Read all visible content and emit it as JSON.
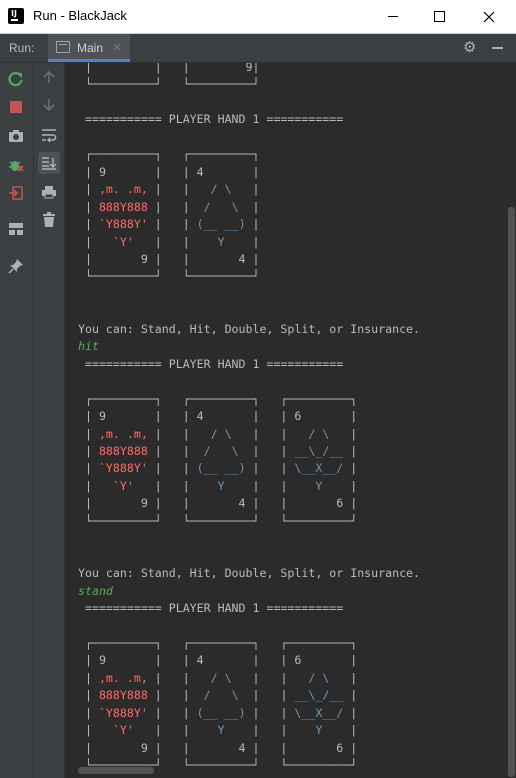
{
  "window": {
    "title": "Run - BlackJack",
    "app_icon_text": "IJ",
    "minimize_icon": "minimize-icon",
    "maximize_icon": "maximize-icon",
    "close_icon": "close-icon"
  },
  "run_header": {
    "label": "Run:",
    "tab_label": "Main",
    "tab_close": "×"
  },
  "toolbar_left": [
    "rerun-icon",
    "stop-icon",
    "screenshot-icon",
    "debug-icon",
    "exit-icon",
    "layout-icon",
    "pin-icon"
  ],
  "toolbar_right": [
    "up-arrow-icon",
    "down-arrow-icon",
    "soft-wrap-icon",
    "scroll-to-end-icon",
    "print-icon",
    "trash-icon"
  ],
  "colors": {
    "background": "#2b2b2b",
    "hearts": "#ff6b68",
    "spades": "#6897bb",
    "user_input": "#5fa85a",
    "text": "#bbbbbb",
    "accent": "#4a88c7"
  },
  "console": {
    "lines": [
      {
        "text": " |         |   |        9|",
        "color": ""
      },
      {
        "text": " └─────────┘   └─────────┘",
        "color": ""
      },
      {
        "text": "",
        "color": ""
      },
      {
        "text": " =========== PLAYER HAND 1 ===========",
        "color": ""
      },
      {
        "text": "",
        "color": ""
      },
      {
        "text": " ┌─────────┐   ┌─────────┐",
        "color": ""
      },
      {
        "text": " | 9       |   | 4       |",
        "color": ""
      },
      {
        "text": " | ,m. .m, |   |   / \\   |",
        "color": "mix1"
      },
      {
        "text": " | 888Y888 |   |  /   \\  |",
        "color": "mix1"
      },
      {
        "text": " | `Y888Y' |   | (__ __) |",
        "color": "mix1"
      },
      {
        "text": " |   `Y'   |   |    Y    |",
        "color": "mix1"
      },
      {
        "text": " |       9 |   |       4 |",
        "color": ""
      },
      {
        "text": " └─────────┘   └─────────┘",
        "color": ""
      },
      {
        "text": "",
        "color": ""
      },
      {
        "text": "",
        "color": ""
      },
      {
        "text": "You can: Stand, Hit, Double, Split, or Insurance.",
        "color": ""
      },
      {
        "text": "hit",
        "color": "green"
      },
      {
        "text": " =========== PLAYER HAND 1 ===========",
        "color": ""
      },
      {
        "text": "",
        "color": ""
      },
      {
        "text": " ┌─────────┐   ┌─────────┐   ┌─────────┐",
        "color": ""
      },
      {
        "text": " | 9       |   | 4       |   | 6       |",
        "color": ""
      },
      {
        "text": " | ,m. .m, |   |   / \\   |   |   / \\   |",
        "color": "mix2"
      },
      {
        "text": " | 888Y888 |   |  /   \\  |   | __\\_/__ |",
        "color": "mix2"
      },
      {
        "text": " | `Y888Y' |   | (__ __) |   | \\__X__/ |",
        "color": "mix2"
      },
      {
        "text": " |   `Y'   |   |    Y    |   |    Y    |",
        "color": "mix2"
      },
      {
        "text": " |       9 |   |       4 |   |       6 |",
        "color": ""
      },
      {
        "text": " └─────────┘   └─────────┘   └─────────┘",
        "color": ""
      },
      {
        "text": "",
        "color": ""
      },
      {
        "text": "",
        "color": ""
      },
      {
        "text": "You can: Stand, Hit, Double, Split, or Insurance.",
        "color": ""
      },
      {
        "text": "stand",
        "color": "green"
      },
      {
        "text": " =========== PLAYER HAND 1 ===========",
        "color": ""
      },
      {
        "text": "",
        "color": ""
      },
      {
        "text": " ┌─────────┐   ┌─────────┐   ┌─────────┐",
        "color": ""
      },
      {
        "text": " | 9       |   | 4       |   | 6       |",
        "color": ""
      },
      {
        "text": " | ,m. .m, |   |   / \\   |   |   / \\   |",
        "color": "mix2"
      },
      {
        "text": " | 888Y888 |   |  /   \\  |   | __\\_/__ |",
        "color": "mix2"
      },
      {
        "text": " | `Y888Y' |   | (__ __) |   | \\__X__/ |",
        "color": "mix2"
      },
      {
        "text": " |   `Y'   |   |    Y    |   |    Y    |",
        "color": "mix2"
      },
      {
        "text": " |       9 |   |       4 |   |       6 |",
        "color": ""
      },
      {
        "text": " └─────────┘   └─────────┘   └─────────┘",
        "color": ""
      }
    ]
  }
}
